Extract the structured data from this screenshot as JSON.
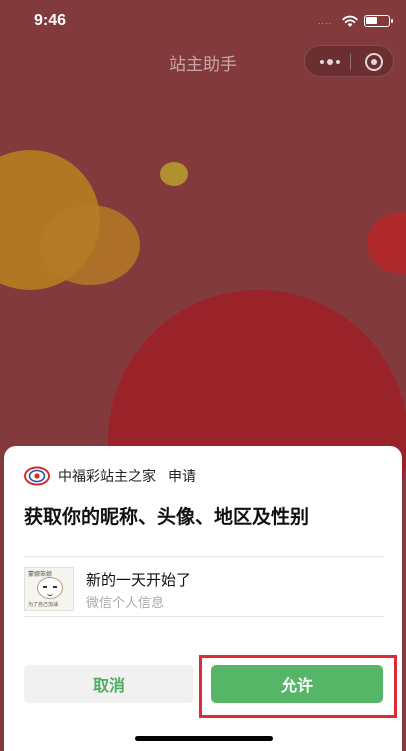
{
  "status_bar": {
    "time": "9:46",
    "signal_dots": "....",
    "battery_level": 0.5
  },
  "nav": {
    "title": "站主助手",
    "more_icon": "more-dots-icon",
    "close_icon": "target-close-icon"
  },
  "dialog": {
    "app_name": "中福彩站主之家",
    "action": "申请",
    "title": "获取你的昵称、头像、地区及性别",
    "account": {
      "nickname": "新的一天开始了",
      "description": "微信个人信息",
      "avatar_top": "蒙娜笨娘",
      "avatar_bottom": "为了自己加油"
    },
    "cancel_label": "取消",
    "allow_label": "允许"
  },
  "colors": {
    "background": "#833a3d",
    "accent_green": "#55b667",
    "highlight_red": "#e02b35"
  }
}
